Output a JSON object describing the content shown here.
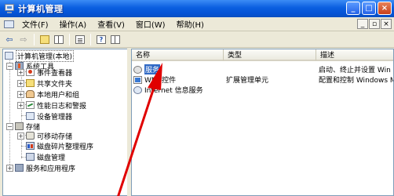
{
  "window": {
    "title": "计算机管理",
    "icon": "computer-management-icon",
    "buttons": [
      "minimize",
      "maximize",
      "close"
    ]
  },
  "menubar": {
    "items": [
      "文件(F)",
      "操作(A)",
      "查看(V)",
      "窗口(W)",
      "帮助(H)"
    ],
    "mdi_buttons": [
      "_",
      "▫",
      "×"
    ]
  },
  "toolbar": {
    "buttons": [
      "back-icon",
      "forward-icon",
      "up-folder-icon",
      "show-hide-tree-icon",
      "properties-icon",
      "help-icon",
      "split-view-icon"
    ]
  },
  "tree": {
    "root": "计算机管理(本地)",
    "groups": [
      {
        "label": "系统工具",
        "children": [
          "事件查看器",
          "共享文件夹",
          "本地用户和组",
          "性能日志和警报",
          "设备管理器"
        ]
      },
      {
        "label": "存储",
        "children": [
          "可移动存储",
          "磁盘碎片整理程序",
          "磁盘管理"
        ]
      },
      {
        "label": "服务和应用程序",
        "children": []
      }
    ]
  },
  "list": {
    "columns": [
      "名称",
      "类型",
      "描述"
    ],
    "rows": [
      {
        "name": "服务",
        "type": "",
        "desc": "启动、终止并设置 Win"
      },
      {
        "name": "WMI 控件",
        "type": "扩展管理单元",
        "desc": "配置和控制 Windows M"
      },
      {
        "name": "Internet 信息服务",
        "type": "",
        "desc": ""
      }
    ]
  },
  "annotation": {
    "color": "#e00000"
  }
}
